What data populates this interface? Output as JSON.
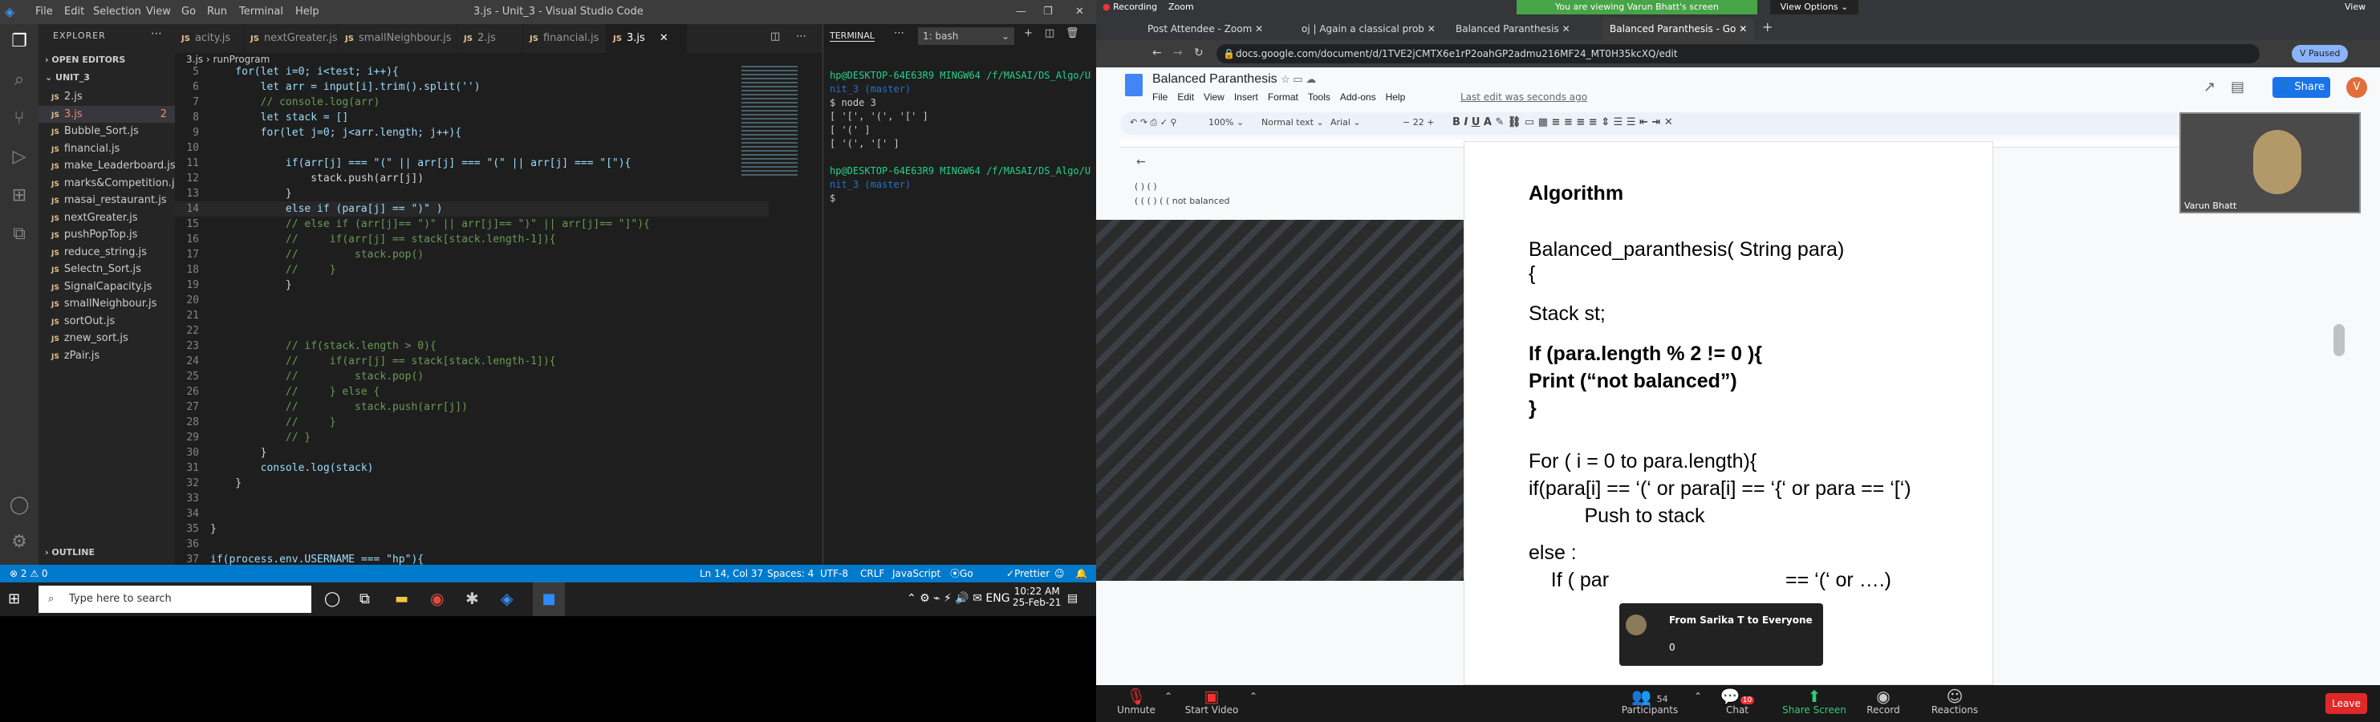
{
  "vscode": {
    "window_title": "3.js - Unit_3 - Visual Studio Code",
    "menu": [
      "File",
      "Edit",
      "Selection",
      "View",
      "Go",
      "Run",
      "Terminal",
      "Help"
    ],
    "explorer_title": "EXPLORER",
    "open_editors": "OPEN EDITORS",
    "folder": "UNIT_3",
    "files": [
      "2.js",
      "3.js",
      "Bubble_Sort.js",
      "financial.js",
      "make_Leaderboard.js",
      "marks&Competition.js",
      "masai_restaurant.js",
      "nextGreater.js",
      "pushPopTop.js",
      "reduce_string.js",
      "Selectn_Sort.js",
      "SignalCapacity.js",
      "smallNeighbour.js",
      "sortOut.js",
      "znew_sort.js",
      "zPair.js"
    ],
    "active_file_badge": "2",
    "outline": "OUTLINE",
    "tabs": [
      "acity.js",
      "nextGreater.js",
      "smallNeighbour.js",
      "2.js",
      "financial.js",
      "3.js"
    ],
    "breadcrumb": [
      "3.js",
      "runProgram"
    ],
    "code_lines": [
      {
        "n": "5",
        "t": "    for(let i=0; i<test; i++){"
      },
      {
        "n": "6",
        "t": "        let arr = input[i].trim().split('')"
      },
      {
        "n": "7",
        "t": "        // console.log(arr)"
      },
      {
        "n": "8",
        "t": "        let stack = []"
      },
      {
        "n": "9",
        "t": "        for(let j=0; j<arr.length; j++){"
      },
      {
        "n": "10",
        "t": ""
      },
      {
        "n": "11",
        "t": "            if(arr[j] === \"(\" || arr[j] === \"(\" || arr[j] === \"[\"){"
      },
      {
        "n": "12",
        "t": "                stack.push(arr[j])"
      },
      {
        "n": "13",
        "t": "            }"
      },
      {
        "n": "14",
        "t": "            else if (para[j] == \")\" )"
      },
      {
        "n": "15",
        "t": "            // else if (arr[j]== \")\" || arr[j]== \")\" || arr[j]== \"]\"){"
      },
      {
        "n": "16",
        "t": "            //     if(arr[j] == stack[stack.length-1]){"
      },
      {
        "n": "17",
        "t": "            //         stack.pop()"
      },
      {
        "n": "18",
        "t": "            //     }"
      },
      {
        "n": "19",
        "t": "            }"
      },
      {
        "n": "20",
        "t": ""
      },
      {
        "n": "21",
        "t": ""
      },
      {
        "n": "22",
        "t": ""
      },
      {
        "n": "23",
        "t": "            // if(stack.length > 0){"
      },
      {
        "n": "24",
        "t": "            //     if(arr[j] == stack[stack.length-1]){"
      },
      {
        "n": "25",
        "t": "            //         stack.pop()"
      },
      {
        "n": "26",
        "t": "            //     } else {"
      },
      {
        "n": "27",
        "t": "            //         stack.push(arr[j])"
      },
      {
        "n": "28",
        "t": "            //     }"
      },
      {
        "n": "29",
        "t": "            // }"
      },
      {
        "n": "30",
        "t": "        }"
      },
      {
        "n": "31",
        "t": "        console.log(stack)"
      },
      {
        "n": "32",
        "t": "    }"
      },
      {
        "n": "33",
        "t": ""
      },
      {
        "n": "34",
        "t": ""
      },
      {
        "n": "35",
        "t": "}"
      },
      {
        "n": "36",
        "t": ""
      },
      {
        "n": "37",
        "t": "if(process.env.USERNAME === \"hp\"){"
      }
    ],
    "terminal_tab": "TERMINAL",
    "terminal_select": "1: bash",
    "terminal_lines": [
      "hp@DESKTOP-64E63R9 MINGW64 /f/MASAI/DS_Algo/U",
      "nit_3 (master)",
      "$ node 3",
      "[ '[', '(', '[' ]",
      "[ '(' ]",
      "[ '(', '[' ]",
      "",
      "hp@DESKTOP-64E63R9 MINGW64 /f/MASAI/DS_Algo/U",
      "nit_3 (master)",
      "$ "
    ],
    "status": {
      "errors": "⊗ 2 ⚠ 0",
      "position": "Ln 14, Col 37",
      "spaces": "Spaces: 4",
      "encoding": "UTF-8",
      "eol": "CRLF",
      "language": "JavaScript",
      "golive": "Go Live",
      "prettier": "Prettier"
    }
  },
  "taskbar": {
    "search_placeholder": "Type here to search",
    "time": "10:22 AM",
    "date": "25-Feb-21"
  },
  "zoom": {
    "banner": "You are viewing Varun Bhatt's screen",
    "view_options": "View Options",
    "recording": "Recording",
    "zoom_label": "Zoom",
    "view_label": "View",
    "chrome_tabs": [
      "Post Attendee - Zoom",
      "oj | Again a classical prob",
      "Balanced Paranthesis",
      "Balanced Paranthesis - Go"
    ],
    "url": "docs.google.com/document/d/1TVE2jCMTX6e1rP2oahGP2admu216MF24_MT0H35kcXQ/edit",
    "paused": "Paused",
    "doc_title": "Balanced Paranthesis",
    "doc_menu": [
      "File",
      "Edit",
      "View",
      "Insert",
      "Format",
      "Tools",
      "Add-ons",
      "Help"
    ],
    "last_edit": "Last edit was seconds ago",
    "share": "Share",
    "toolbar": {
      "zoom": "100%",
      "style": "Normal text",
      "font": "Arial",
      "size": "22"
    },
    "outline_preview": [
      "( ) ( )",
      "( ( ( ) ( (  not balanced"
    ],
    "doc_lines": [
      {
        "t": "Algorithm",
        "b": true
      },
      {
        "t": "Balanced_paranthesis( String para)",
        "b": false
      },
      {
        "t": "{",
        "b": false
      },
      {
        "t": "Stack st;",
        "b": false
      },
      {
        "t": "If (para.length % 2 != 0 ){",
        "b": true
      },
      {
        "t": "Print (“not balanced”)",
        "b": true
      },
      {
        "t": "}",
        "b": true
      },
      {
        "t": "For ( i = 0 to para.length){",
        "b": false
      },
      {
        "t": "if(para[i] == ‘(‘ or para[i] == ‘{‘ or para == ‘[‘)",
        "b": false
      },
      {
        "t": "          Push to stack",
        "b": false
      },
      {
        "t": "else :",
        "b": false
      },
      {
        "t": "    If ( par",
        "b": false
      }
    ],
    "doc_line_tail": "== ‘(‘ or ….)",
    "participant_name": "Varun Bhatt",
    "chat_popup": {
      "title": "From Sarika T to Everyone",
      "message": "0"
    },
    "controls": [
      {
        "label": "Unmute",
        "icon": "mic-muted-icon"
      },
      {
        "label": "Start Video",
        "icon": "video-off-icon"
      },
      {
        "label": "Participants",
        "icon": "participants-icon",
        "count": "54"
      },
      {
        "label": "Chat",
        "icon": "chat-icon",
        "badge": "10"
      },
      {
        "label": "Share Screen",
        "icon": "share-screen-icon"
      },
      {
        "label": "Record",
        "icon": "record-icon"
      },
      {
        "label": "Reactions",
        "icon": "reactions-icon"
      }
    ],
    "leave": "Leave"
  }
}
